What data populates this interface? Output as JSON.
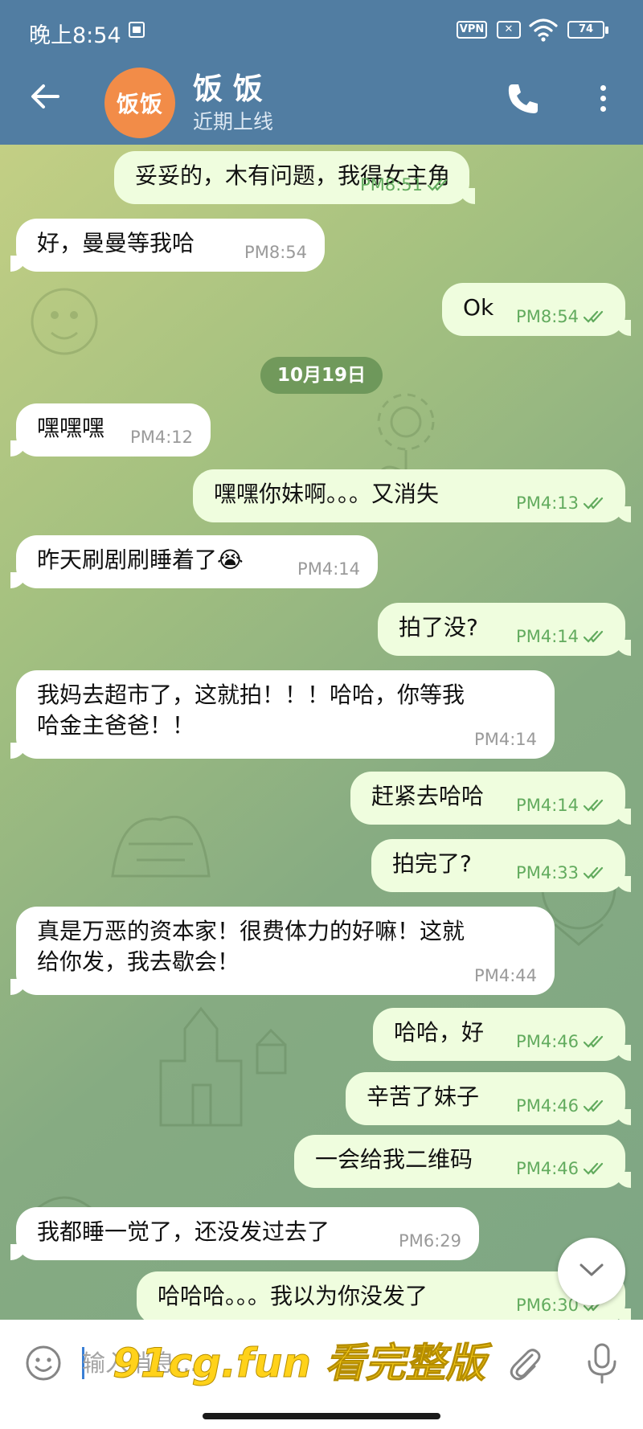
{
  "status_bar": {
    "time": "晚上8:54",
    "vpn": "VPN",
    "battery": "74"
  },
  "header": {
    "avatar_text": "饭饭",
    "name": "饭 饭",
    "status": "近期上线"
  },
  "date_divider": "10月19日",
  "messages": [
    {
      "dir": "out",
      "text": "妥妥的，木有问题，我得女主角",
      "time": "PM8:51"
    },
    {
      "dir": "in",
      "text": "好，曼曼等我哈",
      "time": "PM8:54"
    },
    {
      "dir": "out",
      "text": "Ok",
      "time": "PM8:54"
    },
    {
      "dir": "in",
      "text": "嘿嘿嘿",
      "time": "PM4:12"
    },
    {
      "dir": "out",
      "text": "嘿嘿你妹啊。。。又消失",
      "time": "PM4:13"
    },
    {
      "dir": "in",
      "text": "昨天刷剧刷睡着了😭",
      "time": "PM4:14"
    },
    {
      "dir": "out",
      "text": "拍了没?",
      "time": "PM4:14"
    },
    {
      "dir": "in",
      "text": "我妈去超市了，这就拍！！！哈哈，你等我",
      "text2": "哈金主爸爸！！",
      "time": "PM4:14"
    },
    {
      "dir": "out",
      "text": "赶紧去哈哈",
      "time": "PM4:14"
    },
    {
      "dir": "out",
      "text": "拍完了?",
      "time": "PM4:33"
    },
    {
      "dir": "in",
      "text": "真是万恶的资本家！很费体力的好嘛！这就",
      "text2": "给你发，我去歇会！",
      "time": "PM4:44"
    },
    {
      "dir": "out",
      "text": "哈哈，好",
      "time": "PM4:46"
    },
    {
      "dir": "out",
      "text": "辛苦了妹子",
      "time": "PM4:46"
    },
    {
      "dir": "out",
      "text": "一会给我二维码",
      "time": "PM4:46"
    },
    {
      "dir": "in",
      "text": "我都睡一觉了，还没发过去了",
      "time": "PM6:29"
    },
    {
      "dir": "out",
      "text": "哈哈哈。。。我以为你没发了",
      "time": "PM6:30"
    }
  ],
  "input": {
    "placeholder": "输入消息..."
  },
  "watermark": "91cg.fun 看完整版",
  "icons": {
    "back": "arrow-left-icon",
    "call": "phone-icon",
    "more": "more-vertical-icon",
    "emoji": "emoji-icon",
    "attach": "paperclip-icon",
    "mic": "microphone-icon",
    "scroll": "chevron-down-icon",
    "read": "double-check-icon"
  },
  "colors": {
    "header": "#517da2",
    "avatar": "#f28c48",
    "bubble_out": "#effdde",
    "bubble_in": "#ffffff",
    "check": "#62ab5e"
  }
}
